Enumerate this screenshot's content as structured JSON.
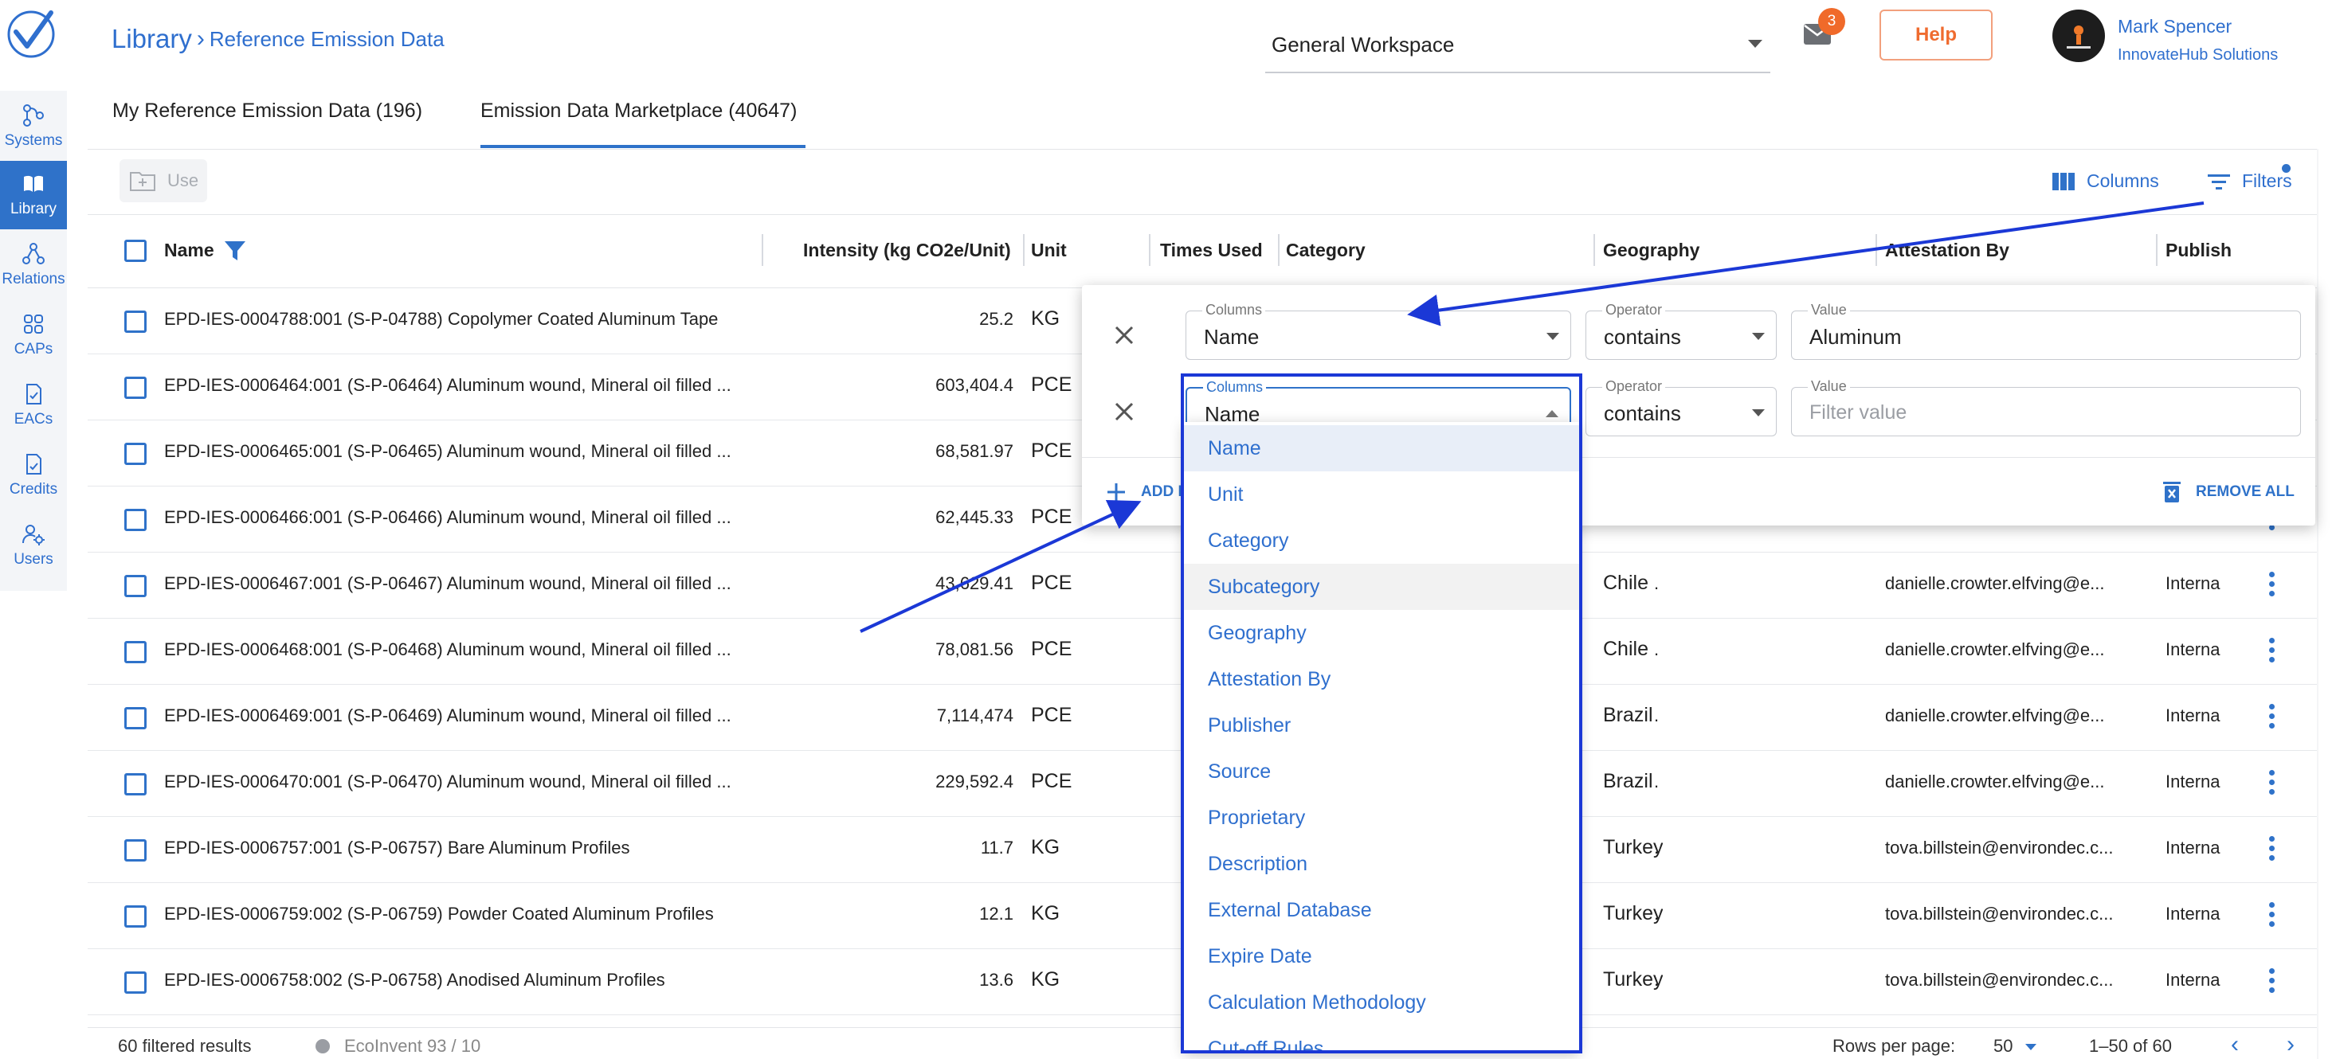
{
  "sidebar": {
    "items": [
      {
        "label": "Systems",
        "icon": "systems-icon"
      },
      {
        "label": "Library",
        "icon": "library-icon",
        "active": true
      },
      {
        "label": "Relations",
        "icon": "relations-icon"
      },
      {
        "label": "CAPs",
        "icon": "caps-icon"
      },
      {
        "label": "EACs",
        "icon": "eacs-icon"
      },
      {
        "label": "Credits",
        "icon": "credits-icon"
      },
      {
        "label": "Users",
        "icon": "users-icon"
      }
    ]
  },
  "header": {
    "breadcrumb_root": "Library",
    "breadcrumb_leaf": "Reference Emission Data",
    "workspace": "General Workspace",
    "mail_count": "3",
    "help_label": "Help",
    "user_name": "Mark Spencer",
    "user_org": "InnovateHub Solutions"
  },
  "tabs": [
    {
      "label": "My Reference Emission Data (196)"
    },
    {
      "label": "Emission Data Marketplace (40647)",
      "active": true
    }
  ],
  "toolbar": {
    "use_label": "Use",
    "columns_label": "Columns",
    "filters_label": "Filters"
  },
  "table": {
    "headers": {
      "name": "Name",
      "intensity": "Intensity (kg CO2e/Unit)",
      "unit": "Unit",
      "times_used": "Times Used",
      "category": "Category",
      "geography": "Geography",
      "attestation": "Attestation By",
      "publisher": "Publish"
    },
    "rows": [
      {
        "name": "EPD-IES-0004788:001 (S-P-04788) Copolymer Coated Aluminum Tape",
        "intensity": "25.2",
        "unit": "KG",
        "cat": "",
        "geo": "",
        "att": "",
        "pub": ""
      },
      {
        "name": "EPD-IES-0006464:001 (S-P-06464) Aluminum wound, Mineral oil filled ...",
        "intensity": "603,404.4",
        "unit": "PCE",
        "cat": "",
        "geo": "",
        "att": "",
        "pub": ""
      },
      {
        "name": "EPD-IES-0006465:001 (S-P-06465) Aluminum wound, Mineral oil filled ...",
        "intensity": "68,581.97",
        "unit": "PCE",
        "cat": "",
        "geo": "",
        "att": "",
        "pub": ""
      },
      {
        "name": "EPD-IES-0006466:001 (S-P-06466) Aluminum wound, Mineral oil filled ...",
        "intensity": "62,445.33",
        "unit": "PCE",
        "cat": "",
        "geo": "",
        "att": "",
        "pub": ""
      },
      {
        "name": "EPD-IES-0006467:001 (S-P-06467) Aluminum wound, Mineral oil filled ...",
        "intensity": "43,629.41",
        "unit": "PCE",
        "cat": ".",
        "geo": "Chile",
        "att": "danielle.crowter.elfving@e...",
        "pub": "Interna"
      },
      {
        "name": "EPD-IES-0006468:001 (S-P-06468) Aluminum wound, Mineral oil filled ...",
        "intensity": "78,081.56",
        "unit": "PCE",
        "cat": ".",
        "geo": "Chile",
        "att": "danielle.crowter.elfving@e...",
        "pub": "Interna"
      },
      {
        "name": "EPD-IES-0006469:001 (S-P-06469) Aluminum wound, Mineral oil filled ...",
        "intensity": "7,114,474",
        "unit": "PCE",
        "cat": ".",
        "geo": "Brazil",
        "att": "danielle.crowter.elfving@e...",
        "pub": "Interna"
      },
      {
        "name": "EPD-IES-0006470:001 (S-P-06470) Aluminum wound, Mineral oil filled ...",
        "intensity": "229,592.4",
        "unit": "PCE",
        "cat": ".",
        "geo": "Brazil",
        "att": "danielle.crowter.elfving@e...",
        "pub": "Interna"
      },
      {
        "name": "EPD-IES-0006757:001 (S-P-06757) Bare Aluminum Profiles",
        "intensity": "11.7",
        "unit": "KG",
        "cat": ".",
        "geo": "Turkey",
        "att": "tova.billstein@environdec.c...",
        "pub": "Interna"
      },
      {
        "name": "EPD-IES-0006759:002 (S-P-06759) Powder Coated Aluminum Profiles",
        "intensity": "12.1",
        "unit": "KG",
        "cat": ".",
        "geo": "Turkey",
        "att": "tova.billstein@environdec.c...",
        "pub": "Interna"
      },
      {
        "name": "EPD-IES-0006758:002 (S-P-06758) Anodised Aluminum Profiles",
        "intensity": "13.6",
        "unit": "KG",
        "cat": ".",
        "geo": "Turkey",
        "att": "tova.billstein@environdec.c...",
        "pub": "Interna"
      }
    ]
  },
  "footer": {
    "results": "60 filtered results",
    "source": "EcoInvent 93 / 10",
    "rows_per_page_label": "Rows per page:",
    "rows_per_page": "50",
    "range": "1–50 of 60"
  },
  "filter_panel": {
    "filters": [
      {
        "columns_label": "Columns",
        "column": "Name",
        "operator_label": "Operator",
        "operator": "contains",
        "value_label": "Value",
        "value": "Aluminum",
        "placeholder": ""
      },
      {
        "columns_label": "Columns",
        "column": "Name",
        "operator_label": "Operator",
        "operator": "contains",
        "value_label": "Value",
        "value": "",
        "placeholder": "Filter value"
      }
    ],
    "add_label": "ADD F",
    "remove_all_label": "REMOVE ALL"
  },
  "column_dropdown": {
    "options": [
      "Name",
      "Unit",
      "Category",
      "Subcategory",
      "Geography",
      "Attestation By",
      "Publisher",
      "Source",
      "Proprietary",
      "Description",
      "External Database",
      "Expire Date",
      "Calculation Methodology",
      "Cut-off Rules"
    ],
    "selected": "Name",
    "hovered": "Subcategory"
  },
  "colors": {
    "accent": "#2f72c9",
    "link": "#2f6fce",
    "help": "#ef6b2f",
    "annotation": "#1b38d6"
  }
}
